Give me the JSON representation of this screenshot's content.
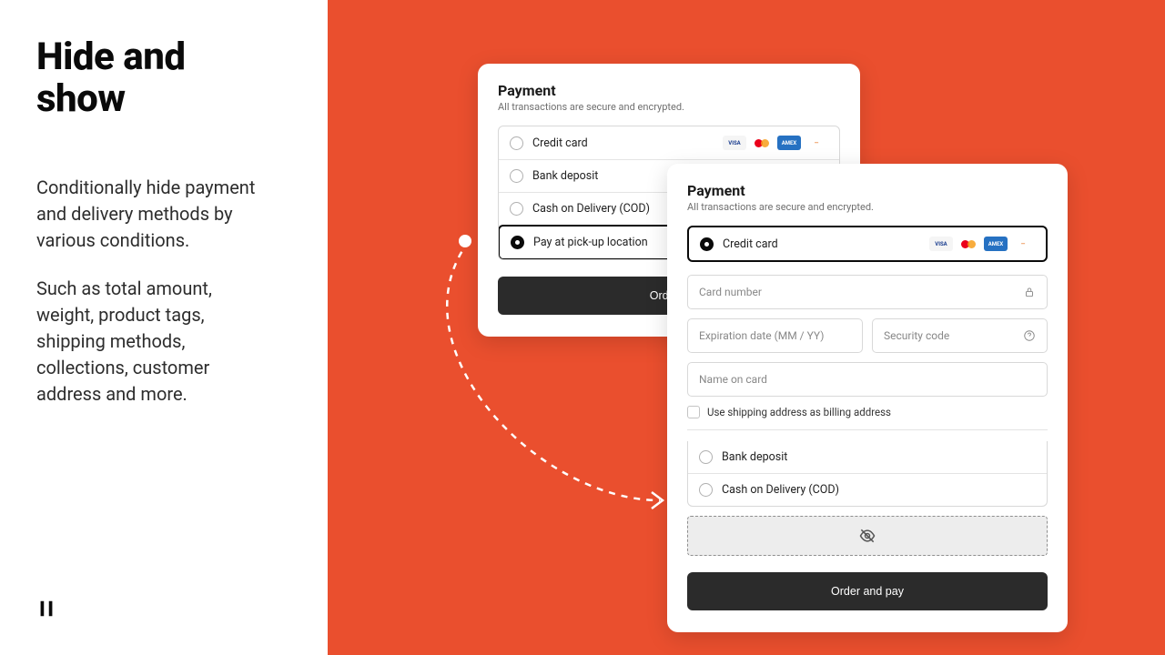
{
  "left": {
    "heading_a": "Hide and",
    "heading_b": "show",
    "p1_a": "Conditionally hide payment",
    "p1_b": "and delivery methods by",
    "p1_c": "various conditions.",
    "p2_a": "Such as total amount,",
    "p2_b": "weight, product tags,",
    "p2_c": "shipping methods,",
    "p2_d": "collections, customer",
    "p2_e": "address and more."
  },
  "cardA": {
    "title": "Payment",
    "sub": "All transactions are secure and encrypted.",
    "opts": {
      "credit": "Credit card",
      "bank": "Bank deposit",
      "cod": "Cash on Delivery (COD)",
      "pickup": "Pay at pick-up location"
    },
    "btn": "Order a"
  },
  "cardB": {
    "title": "Payment",
    "sub": "All transactions are secure and encrypted.",
    "credit": "Credit card",
    "card_number": "Card number",
    "exp": "Expiration date (MM / YY)",
    "cvv": "Security code",
    "name": "Name on card",
    "use_ship": "Use shipping address as billing address",
    "bank": "Bank deposit",
    "cod": "Cash on Delivery (COD)",
    "btn": "Order and pay"
  },
  "logos": {
    "visa": "VISA",
    "amex": "AMEX"
  }
}
